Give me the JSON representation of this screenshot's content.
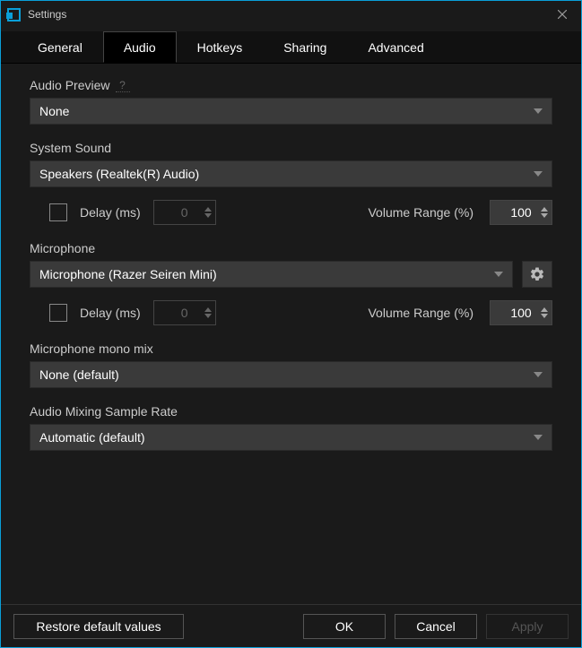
{
  "window": {
    "title": "Settings"
  },
  "tabs": {
    "general": "General",
    "audio": "Audio",
    "hotkeys": "Hotkeys",
    "sharing": "Sharing",
    "advanced": "Advanced",
    "active": "audio"
  },
  "audio_preview": {
    "label": "Audio Preview",
    "value": "None"
  },
  "system_sound": {
    "label": "System Sound",
    "value": "Speakers (Realtek(R) Audio)",
    "delay_label": "Delay (ms)",
    "delay_value": "0",
    "delay_checked": false,
    "volume_label": "Volume Range (%)",
    "volume_value": "100"
  },
  "microphone": {
    "label": "Microphone",
    "value": "Microphone (Razer Seiren Mini)",
    "delay_label": "Delay (ms)",
    "delay_value": "0",
    "delay_checked": false,
    "volume_label": "Volume Range (%)",
    "volume_value": "100"
  },
  "mono_mix": {
    "label": "Microphone mono mix",
    "value": "None (default)"
  },
  "sample_rate": {
    "label": "Audio Mixing Sample Rate",
    "value": "Automatic (default)"
  },
  "footer": {
    "restore": "Restore default values",
    "ok": "OK",
    "cancel": "Cancel",
    "apply": "Apply"
  }
}
